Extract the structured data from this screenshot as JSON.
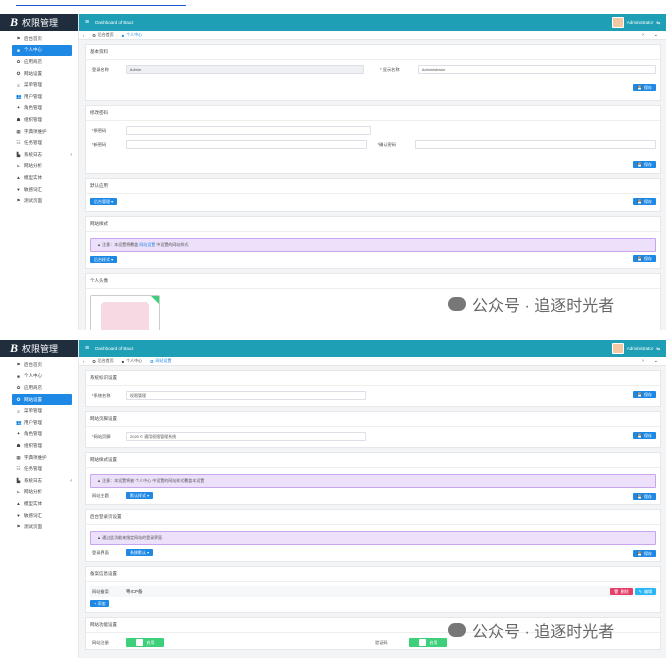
{
  "app": {
    "title": "权限管理",
    "logo_letter": "B",
    "breadcrumb": "Dashboard of Baoz",
    "username": "Administrator"
  },
  "sidebar": {
    "items": [
      {
        "label": "后台首页",
        "icon": "flag-icon",
        "glyph": "⚑"
      },
      {
        "label": "个人中心",
        "icon": "user-icon",
        "glyph": "■"
      },
      {
        "label": "应用商店",
        "icon": "store-icon",
        "glyph": "✿"
      },
      {
        "label": "网站设置",
        "icon": "settings-icon",
        "glyph": "✪"
      },
      {
        "label": "菜单管理",
        "icon": "menu-icon",
        "glyph": "≡"
      },
      {
        "label": "用户管理",
        "icon": "users-icon",
        "glyph": "👥"
      },
      {
        "label": "角色管理",
        "icon": "roles-icon",
        "glyph": "✦"
      },
      {
        "label": "组织管理",
        "icon": "org-icon",
        "glyph": "☗"
      },
      {
        "label": "字典项维护",
        "icon": "dict-icon",
        "glyph": "▦"
      },
      {
        "label": "任务管理",
        "icon": "task-icon",
        "glyph": "☷"
      },
      {
        "label": "系统日志",
        "icon": "log-icon",
        "glyph": "▙",
        "has_caret": true
      },
      {
        "label": "网站分析",
        "icon": "chart-icon",
        "glyph": "⊾"
      },
      {
        "label": "模型实体",
        "icon": "model-icon",
        "glyph": "▲"
      },
      {
        "label": "敏感词汇",
        "icon": "shield-icon",
        "glyph": "♥"
      },
      {
        "label": "测试页面",
        "icon": "page-icon",
        "glyph": "⚑"
      }
    ]
  },
  "shot1": {
    "tabs": [
      "后台首页",
      "个人中心"
    ],
    "active_menu_index": 1,
    "basic": {
      "title": "基本资料",
      "login_label": "登录名称",
      "login_value": "Admin",
      "display_label": "* 显示名称",
      "display_value": "Administrator",
      "save": "保存"
    },
    "password": {
      "title": "修改密码",
      "old_label": "*原密码",
      "new_label": "*新密码",
      "confirm_label": "*确认密码",
      "save": "保存"
    },
    "default_app": {
      "title": "默认应用",
      "button": "后台管理 ▾",
      "save": "保存"
    },
    "style": {
      "title": "网站样式",
      "alert_prefix": "▲ 注意：本设置将覆盖",
      "alert_link": "网站设置",
      "alert_suffix": "中设置的网站样式",
      "button": "后台样式 ▾",
      "save": "保存"
    },
    "avatar": {
      "title": "个人头像"
    }
  },
  "shot2": {
    "tabs": [
      "后台首页",
      "个人中心",
      "网站设置"
    ],
    "active_menu_index": 3,
    "sys_title": {
      "title": "系统标识设置",
      "label": "*系统名称",
      "value": "权限管理",
      "save": "保存"
    },
    "copyright": {
      "title": "网站页脚设置",
      "label": "*网站页脚",
      "value": "2020 © 通用权限管理系统",
      "save": "保存"
    },
    "style": {
      "title": "网站样式设置",
      "alert_text": "▲ 注意：本设置将被 个人中心 中设置的网站样式覆盖本设置",
      "label": "网站主题",
      "button": "默认样式 ▾",
      "save": "保存"
    },
    "home": {
      "title": "后台登录页设置",
      "alert_text": "▲ 通过此功能来指定网站的登录界面",
      "label": "登录界面",
      "button": "系统默认 ▾",
      "save": "保存"
    },
    "record": {
      "title": "备案信息设置",
      "label": "网站备案",
      "value": "粤ICP备",
      "delete": "删除",
      "edit": "编辑",
      "add": "+ 添加"
    },
    "functions": {
      "title": "网站功能设置",
      "label_left": "网站注册",
      "toggle_left": "启用",
      "label_right": "验证码",
      "toggle_right": "启用"
    }
  },
  "watermark": "公众号 · 追逐时光者"
}
